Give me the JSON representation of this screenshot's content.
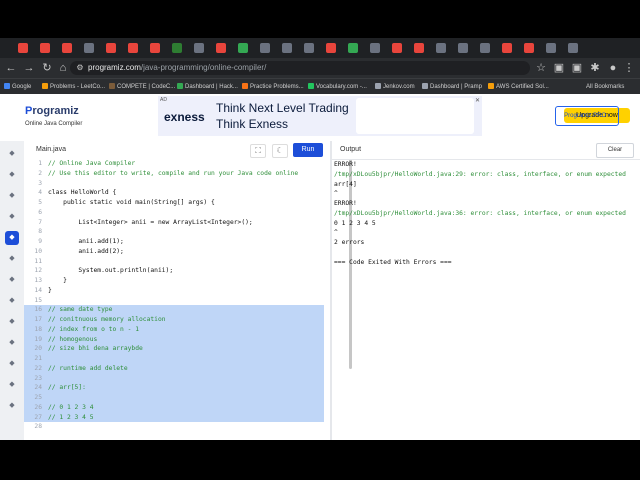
{
  "browser": {
    "tab_colors": [
      "#e8453c",
      "#e8453c",
      "#e8453c",
      "#6b7280",
      "#e8453c",
      "#e8453c",
      "#e8453c",
      "#2e7d32",
      "#6b7280",
      "#e8453c",
      "#34a853",
      "#6b7280",
      "#6b7280",
      "#6b7280",
      "#e8453c",
      "#34a853",
      "#6b7280",
      "#e8453c",
      "#e8453c",
      "#6b7280",
      "#6b7280",
      "#6b7280",
      "#e8453c",
      "#e8453c",
      "#6b7280",
      "#6b7280"
    ],
    "url_host": "programiz.com",
    "url_path": "/java-programming/online-compiler/",
    "bookmarks": [
      {
        "label": "Google",
        "color": "#4285f4"
      },
      {
        "label": "Problems - LeetCo...",
        "color": "#f59e0b"
      },
      {
        "label": "COMPETE | CodeC...",
        "color": "#7c5c3a"
      },
      {
        "label": "Dashboard | Hack...",
        "color": "#34a853"
      },
      {
        "label": "Practice Problems...",
        "color": "#f97316"
      },
      {
        "label": "Vocabulary.com -...",
        "color": "#22c55e"
      },
      {
        "label": "Jenkov.com",
        "color": "#9ca3af"
      },
      {
        "label": "Dashboard | Pramp",
        "color": "#9ca3af"
      },
      {
        "label": "AWS Certified Sol...",
        "color": "#f59e0b"
      }
    ],
    "all_bookmarks": "All Bookmarks"
  },
  "header": {
    "logo_p": "P",
    "logo_rest": "rogramiz",
    "logo_sub": "Online Java Compiler",
    "pro_button": "Programiz PRO ›"
  },
  "ad": {
    "tag": "AD",
    "brand": "exness",
    "headline1": "Think Next Level Trading",
    "headline2": "Think Exness",
    "cta": "Upgrade now",
    "close": "✕"
  },
  "editor": {
    "file_tab": "Main.java",
    "run_label": "Run",
    "lines": [
      {
        "n": "1",
        "text": "// Online Java Compiler",
        "cmt": true,
        "sel": false
      },
      {
        "n": "2",
        "text": "// Use this editor to write, compile and run your Java code online",
        "cmt": true,
        "sel": false
      },
      {
        "n": "3",
        "text": "",
        "cmt": false,
        "sel": false
      },
      {
        "n": "4",
        "text": "class HelloWorld {",
        "cmt": false,
        "sel": false
      },
      {
        "n": "5",
        "text": "    public static void main(String[] args) {",
        "cmt": false,
        "sel": false
      },
      {
        "n": "6",
        "text": "",
        "cmt": false,
        "sel": false
      },
      {
        "n": "7",
        "text": "        List<Integer> anii = new ArrayList<Integer>();",
        "cmt": false,
        "sel": false
      },
      {
        "n": "8",
        "text": "",
        "cmt": false,
        "sel": false
      },
      {
        "n": "9",
        "text": "        anii.add(1);",
        "cmt": false,
        "sel": false
      },
      {
        "n": "10",
        "text": "        anii.add(2);",
        "cmt": false,
        "sel": false
      },
      {
        "n": "11",
        "text": "",
        "cmt": false,
        "sel": false
      },
      {
        "n": "12",
        "text": "        System.out.println(anii);",
        "cmt": false,
        "sel": false
      },
      {
        "n": "13",
        "text": "    }",
        "cmt": false,
        "sel": false
      },
      {
        "n": "14",
        "text": "}",
        "cmt": false,
        "sel": false
      },
      {
        "n": "15",
        "text": "",
        "cmt": false,
        "sel": false
      },
      {
        "n": "16",
        "text": "// same date type",
        "cmt": true,
        "sel": true
      },
      {
        "n": "17",
        "text": "// conitnuous memory allocation",
        "cmt": true,
        "sel": true
      },
      {
        "n": "18",
        "text": "// index from o to n - 1",
        "cmt": true,
        "sel": true
      },
      {
        "n": "19",
        "text": "// homogenous",
        "cmt": true,
        "sel": true
      },
      {
        "n": "20",
        "text": "// size bhi dena arraybde",
        "cmt": true,
        "sel": true
      },
      {
        "n": "21",
        "text": "",
        "cmt": false,
        "sel": true
      },
      {
        "n": "22",
        "text": "// runtime add delete",
        "cmt": true,
        "sel": true
      },
      {
        "n": "23",
        "text": "",
        "cmt": false,
        "sel": true
      },
      {
        "n": "24",
        "text": "// arr[5]:",
        "cmt": true,
        "sel": true
      },
      {
        "n": "25",
        "text": "",
        "cmt": false,
        "sel": true
      },
      {
        "n": "26",
        "text": "// 0 1 2 3 4",
        "cmt": true,
        "sel": true
      },
      {
        "n": "27",
        "text": "// 1 2 3 4 5",
        "cmt": true,
        "sel": true
      },
      {
        "n": "28",
        "text": "",
        "cmt": false,
        "sel": false
      }
    ]
  },
  "output": {
    "title": "Output",
    "clear_label": "Clear",
    "lines": [
      {
        "text": "ERROR!",
        "err": false
      },
      {
        "text": "/tmp/xDLou5bjpr/HelloWorld.java:29: error: class, interface, or enum expected",
        "err": true
      },
      {
        "text": "arr[4]",
        "err": false
      },
      {
        "text": "^",
        "err": false
      },
      {
        "text": "ERROR!",
        "err": false
      },
      {
        "text": "/tmp/xDLou5bjpr/HelloWorld.java:36: error: class, interface, or enum expected",
        "err": true
      },
      {
        "text": "0 1 2 3 4 5",
        "err": false
      },
      {
        "text": "^",
        "err": false
      },
      {
        "text": "2 errors",
        "err": false
      },
      {
        "text": "",
        "err": false
      },
      {
        "text": "=== Code Exited With Errors ===",
        "err": false
      }
    ]
  },
  "sidebar_langs": [
    "py",
    "r",
    "sql",
    "html",
    "java",
    "c",
    "c++",
    "c#",
    "js",
    "go",
    "php",
    "swift",
    "rs"
  ]
}
